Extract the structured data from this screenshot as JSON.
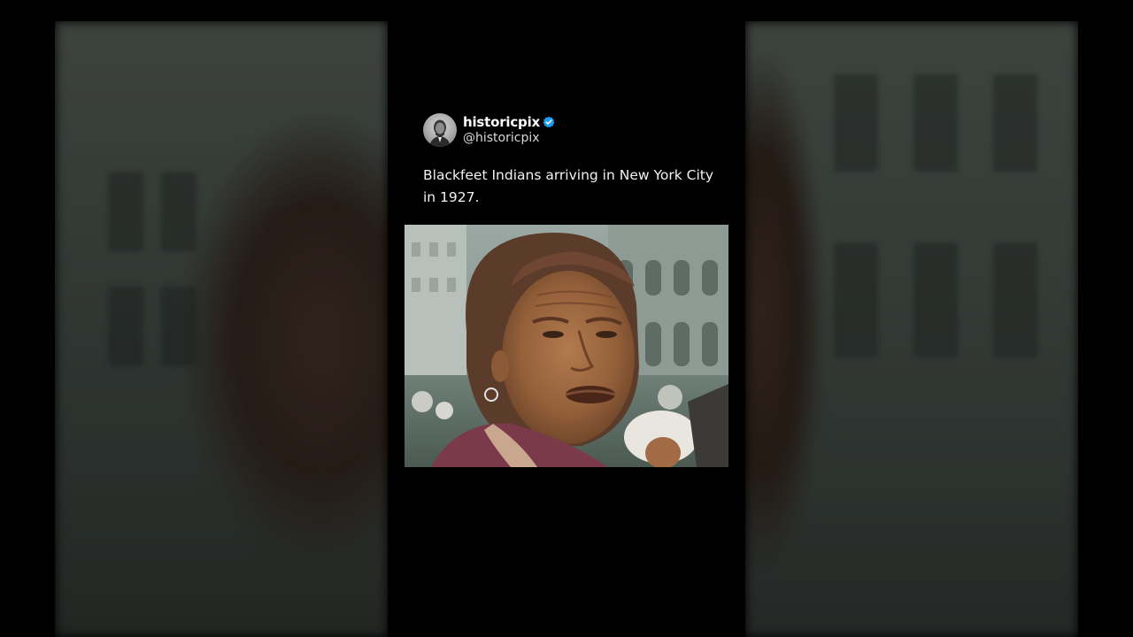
{
  "post": {
    "display_name": "historicpix",
    "handle": "@historicpix",
    "verified": true,
    "text": "Blackfeet Indians arriving in New York City in 1927."
  },
  "icons": {
    "avatar": "portrait-avatar-icon",
    "verified": "verified-badge-icon"
  },
  "colors": {
    "background": "#000000",
    "verified_badge": "#1d9bf0",
    "text": "#ffffff"
  }
}
